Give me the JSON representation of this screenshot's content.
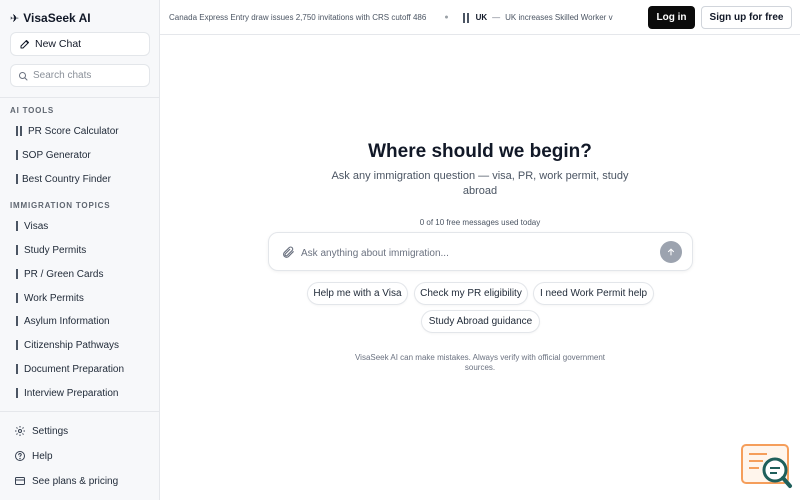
{
  "app": {
    "brand": "VisaSeek AI"
  },
  "sidebar": {
    "new_chat": "New Chat",
    "search_placeholder": "Search chats",
    "ai_tools_label": "AI TOOLS",
    "ai_tools": [
      {
        "label": "PR Score Calculator",
        "icon": "flag-icon"
      },
      {
        "label": "SOP Generator",
        "icon": "bar-icon"
      },
      {
        "label": "Best Country Finder",
        "icon": "bar-icon"
      }
    ],
    "topics_label": "IMMIGRATION TOPICS",
    "topics": [
      {
        "label": "Visas"
      },
      {
        "label": "Study Permits"
      },
      {
        "label": "PR / Green Cards"
      },
      {
        "label": "Work Permits"
      },
      {
        "label": "Asylum Information"
      },
      {
        "label": "Citizenship Pathways"
      },
      {
        "label": "Document Preparation"
      },
      {
        "label": "Interview Preparation"
      }
    ],
    "footer": [
      {
        "label": "Settings",
        "icon": "gear-icon"
      },
      {
        "label": "Help",
        "icon": "help-icon"
      },
      {
        "label": "See plans & pricing",
        "icon": "card-icon"
      }
    ]
  },
  "topbar": {
    "ticker": [
      {
        "country": "",
        "text": "Canada Express Entry draw issues 2,750 invitations with CRS cutoff 486"
      },
      {
        "country": "UK",
        "text": "UK increases Skilled Worker v"
      }
    ],
    "ticker_dash": "—",
    "ticker_separator": "●",
    "login": "Log in",
    "signup": "Sign up for free"
  },
  "main": {
    "heading": "Where should we begin?",
    "subheading": "Ask any immigration question — visa, PR, work permit, study abroad",
    "usage": "0 of 10 free messages used today",
    "composer_placeholder": "Ask anything about immigration...",
    "suggestions": [
      "Help me with a Visa",
      "Check my PR eligibility",
      "I need Work Permit help",
      "Study Abroad guidance"
    ],
    "disclaimer": "VisaSeek AI can make mistakes. Always verify with official government sources."
  },
  "colors": {
    "accent": "#0b0b0b",
    "sidebar_bg": "#f7f8fa",
    "send_button": "#9ca3af",
    "widget_orange": "#f59e5b",
    "widget_teal": "#1f5f5b"
  }
}
